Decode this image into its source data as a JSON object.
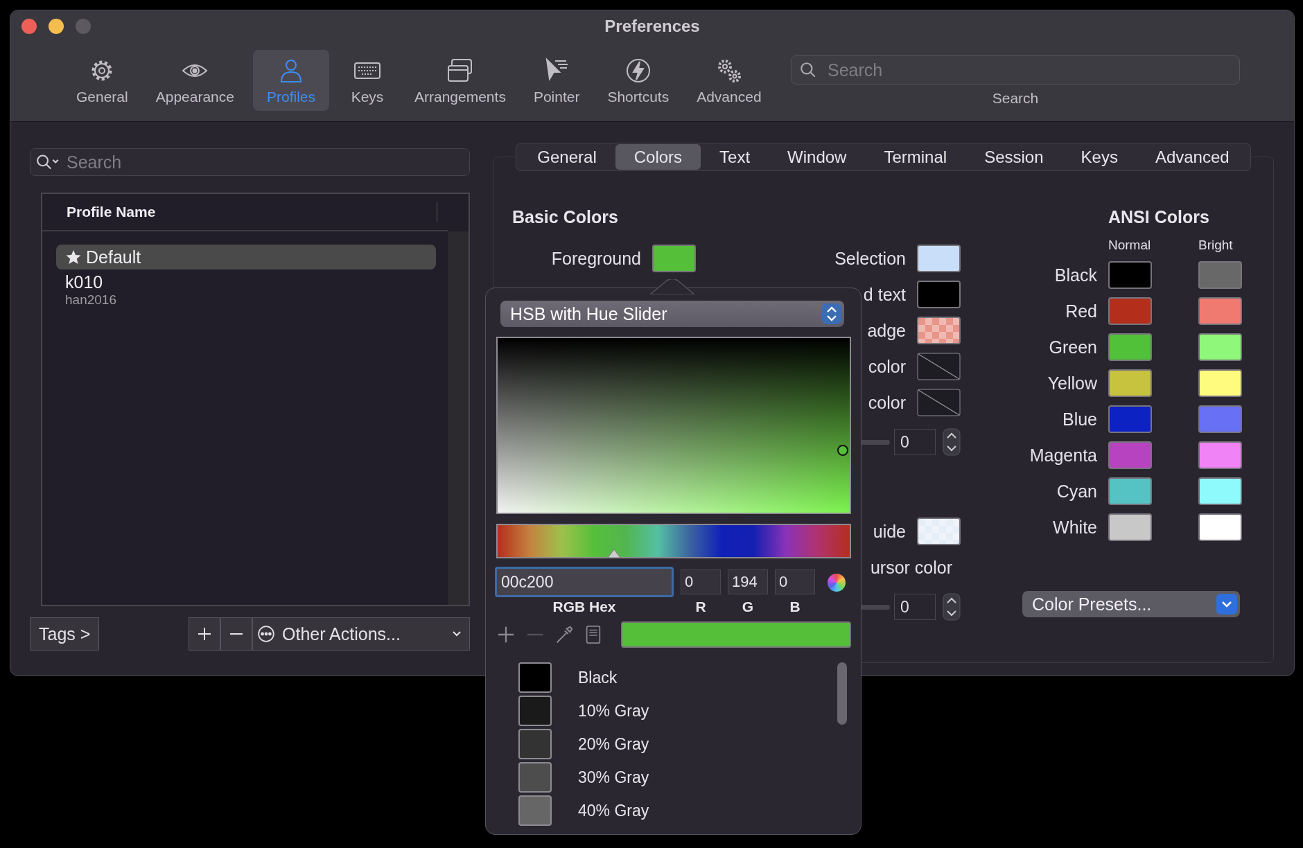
{
  "window": {
    "title": "Preferences"
  },
  "toolbar": {
    "items": [
      {
        "label": "General",
        "kind": "gear",
        "selected": false
      },
      {
        "label": "Appearance",
        "kind": "eye",
        "selected": false
      },
      {
        "label": "Profiles",
        "kind": "person",
        "selected": true
      },
      {
        "label": "Keys",
        "kind": "keyboard",
        "selected": false
      },
      {
        "label": "Arrangements",
        "kind": "windows",
        "selected": false
      },
      {
        "label": "Pointer",
        "kind": "pointer",
        "selected": false
      },
      {
        "label": "Shortcuts",
        "kind": "bolt",
        "selected": false
      },
      {
        "label": "Advanced",
        "kind": "gears",
        "selected": false
      }
    ],
    "search": {
      "placeholder": "Search",
      "label": "Search"
    }
  },
  "profiles": {
    "search_placeholder": "Search",
    "column": "Profile Name",
    "rows": [
      {
        "name": "Default",
        "default": true,
        "selected": true
      },
      {
        "name": "k010",
        "tags": "han2016",
        "default": false,
        "selected": false
      }
    ],
    "tags_button": "Tags >",
    "other_actions": "Other Actions..."
  },
  "tabs": [
    {
      "label": "General",
      "selected": false
    },
    {
      "label": "Colors",
      "selected": true
    },
    {
      "label": "Text",
      "selected": false
    },
    {
      "label": "Window",
      "selected": false
    },
    {
      "label": "Terminal",
      "selected": false
    },
    {
      "label": "Session",
      "selected": false
    },
    {
      "label": "Keys",
      "selected": false
    },
    {
      "label": "Advanced",
      "selected": false
    }
  ],
  "basic_colors": {
    "title": "Basic Colors",
    "foreground": {
      "label": "Foreground",
      "color": "#56bf3a"
    },
    "groups": [
      [
        {
          "kind": "swatch",
          "label": "Selection",
          "color": "#c9def9"
        },
        {
          "kind": "swatch",
          "label": "d text",
          "color": "#000000"
        },
        {
          "kind": "checker",
          "label": "adge",
          "color": "#e8958a"
        },
        {
          "kind": "none",
          "label": "color"
        },
        {
          "kind": "none",
          "label": "color"
        },
        {
          "kind": "stepper",
          "value": "0"
        }
      ],
      [
        {
          "kind": "checker",
          "label": "uide",
          "color": "#e6eef8"
        },
        {
          "kind": "label",
          "label": "ursor color"
        },
        {
          "kind": "stepper",
          "value": "0"
        }
      ]
    ]
  },
  "ansi": {
    "title": "ANSI Colors",
    "columns": [
      "Normal",
      "Bright"
    ],
    "rows": [
      {
        "name": "Black",
        "swatches": [
          {
            "color": "#000000"
          },
          {
            "color": "#686868"
          }
        ]
      },
      {
        "name": "Red",
        "swatches": [
          {
            "color": "#b42f1b"
          },
          {
            "color": "#f07a6f"
          }
        ]
      },
      {
        "name": "Green",
        "swatches": [
          {
            "color": "#52c13a"
          },
          {
            "color": "#8ff77a"
          }
        ]
      },
      {
        "name": "Yellow",
        "swatches": [
          {
            "color": "#c8c33f"
          },
          {
            "color": "#fefb7f"
          }
        ]
      },
      {
        "name": "Blue",
        "swatches": [
          {
            "color": "#0c22c2"
          },
          {
            "color": "#6871f6"
          }
        ]
      },
      {
        "name": "Magenta",
        "swatches": [
          {
            "color": "#b843c1"
          },
          {
            "color": "#f083f6"
          }
        ]
      },
      {
        "name": "Cyan",
        "swatches": [
          {
            "color": "#55c2c4"
          },
          {
            "color": "#8ffafc"
          }
        ]
      },
      {
        "name": "White",
        "swatches": [
          {
            "color": "#c8c8c8"
          },
          {
            "color": "#ffffff"
          }
        ]
      }
    ],
    "presets": "Color Presets..."
  },
  "color_picker": {
    "mode": "HSB with Hue Slider",
    "hue": {
      "level": 0.33
    },
    "hex": "00c200",
    "hex_label": "RGB Hex",
    "channels": [
      {
        "label": "R",
        "value": "0"
      },
      {
        "label": "G",
        "value": "194"
      },
      {
        "label": "B",
        "value": "0"
      }
    ],
    "current": {
      "color": "#56bf3a"
    },
    "swatches": [
      {
        "name": "Black",
        "color": "#000000"
      },
      {
        "name": "10% Gray",
        "color": "#1a1a1a"
      },
      {
        "name": "20% Gray",
        "color": "#333333"
      },
      {
        "name": "30% Gray",
        "color": "#4d4d4d"
      },
      {
        "name": "40% Gray",
        "color": "#666666"
      }
    ]
  }
}
